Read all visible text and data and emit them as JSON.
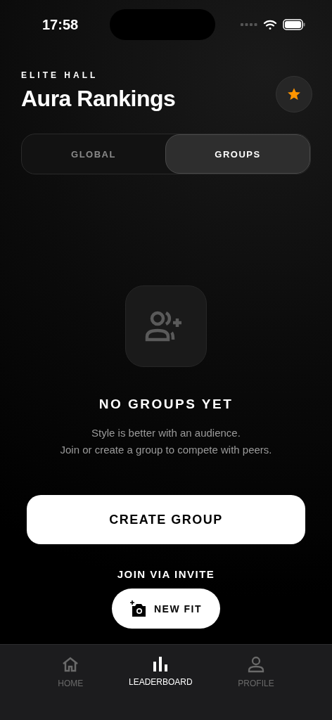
{
  "status_bar": {
    "time": "17:58"
  },
  "header": {
    "eyebrow": "ELITE HALL",
    "title": "Aura Rankings"
  },
  "tabs": [
    {
      "label": "GLOBAL",
      "selected": false
    },
    {
      "label": "GROUPS",
      "selected": true
    }
  ],
  "empty_state": {
    "heading": "NO GROUPS YET",
    "lines": [
      "Style is better with an audience.",
      "Join or create a group to compete with peers."
    ]
  },
  "primary_button": "CREATE GROUP",
  "join_link": "JOIN VIA INVITE",
  "new_fit_button": "NEW FIT",
  "bottom_nav": [
    {
      "kind": "home",
      "label": "HOME",
      "selected": false
    },
    {
      "kind": "leaderboard",
      "label": "LEADERBOARD",
      "selected": true
    },
    {
      "kind": "profile",
      "label": "PROFILE",
      "selected": false
    }
  ]
}
